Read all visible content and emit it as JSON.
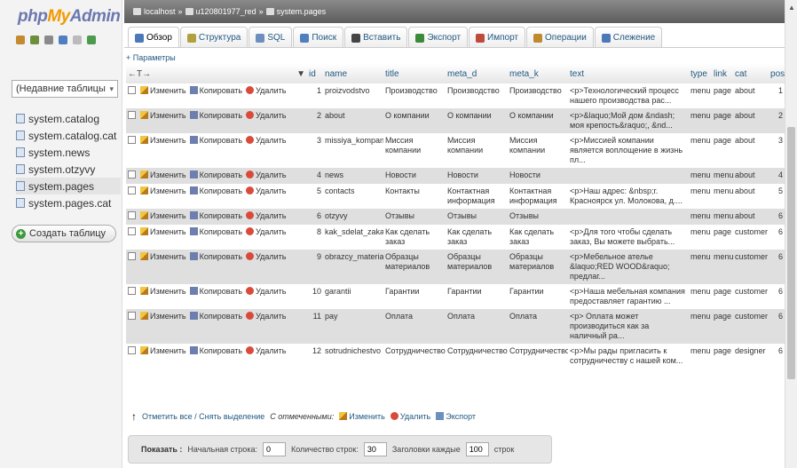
{
  "logo": {
    "php": "php",
    "my": "My",
    "admin": "Admin"
  },
  "left": {
    "recent_tables": "(Недавние таблицы",
    "tables": [
      "system.catalog",
      "system.catalog.cat",
      "system.news",
      "system.otzyvy",
      "system.pages",
      "system.pages.cat"
    ],
    "selected": "system.pages",
    "create_table": "Создать таблицу"
  },
  "breadcrumb": {
    "server": "localhost",
    "db": "u120801977_red",
    "table": "system.pages"
  },
  "tabs": [
    "Обзор",
    "Структура",
    "SQL",
    "Поиск",
    "Вставить",
    "Экспорт",
    "Импорт",
    "Операции",
    "Слежение"
  ],
  "params_label": "+ Параметры",
  "columns": [
    "id",
    "name",
    "title",
    "meta_d",
    "meta_k",
    "text",
    "type",
    "link",
    "cat",
    "pos"
  ],
  "actions": {
    "edit": "Изменить",
    "copy": "Копировать",
    "delete": "Удалить"
  },
  "rows": [
    {
      "id": "1",
      "name": "proizvodstvo",
      "title": "Производство",
      "meta_d": "Производство",
      "meta_k": "Производство",
      "text": "<p>Технологический процесс нашего производства рас...",
      "type": "menu",
      "link": "page",
      "cat": "about",
      "pos": "1"
    },
    {
      "id": "2",
      "name": "about",
      "title": "О компании",
      "meta_d": "О компании",
      "meta_k": "О компании",
      "text": "<p>&laquo;Мой дом &ndash; моя крепость&raquo;, &nd...",
      "type": "menu",
      "link": "page",
      "cat": "about",
      "pos": "2"
    },
    {
      "id": "3",
      "name": "missiya_kompanii",
      "title": "Миссия компании",
      "meta_d": "Миссия компании",
      "meta_k": "Миссия компании",
      "text": "<p>Миссией компании является воплощение в жизнь пл...",
      "type": "menu",
      "link": "page",
      "cat": "about",
      "pos": "3"
    },
    {
      "id": "4",
      "name": "news",
      "title": "Новости",
      "meta_d": "Новости",
      "meta_k": "Новости",
      "text": "",
      "type": "menu",
      "link": "menu",
      "cat": "about",
      "pos": "4"
    },
    {
      "id": "5",
      "name": "contacts",
      "title": "Контакты",
      "meta_d": "Контактная информация",
      "meta_k": "Контактная информация",
      "text": "<p>Наш адрес: &nbsp;г. Красноярск ул. Молокова, д....",
      "type": "menu",
      "link": "menu",
      "cat": "about",
      "pos": "5"
    },
    {
      "id": "6",
      "name": "otzyvy",
      "title": "Отзывы",
      "meta_d": "Отзывы",
      "meta_k": "Отзывы",
      "text": "",
      "type": "menu",
      "link": "menu",
      "cat": "about",
      "pos": "6"
    },
    {
      "id": "8",
      "name": "kak_sdelat_zakaz",
      "title": "Как сделать заказ",
      "meta_d": "Как сделать заказ",
      "meta_k": "Как сделать заказ",
      "text": "<p>Для того чтобы сделать заказ, Вы можете выбрать...",
      "type": "menu",
      "link": "page",
      "cat": "customer",
      "pos": "6"
    },
    {
      "id": "9",
      "name": "obrazcy_materialov",
      "title": "Образцы материалов",
      "meta_d": "Образцы материалов",
      "meta_k": "Образцы материалов",
      "text": "<p>Мебельное ателье &laquo;RED WOOD&raquo; предлаг...",
      "type": "menu",
      "link": "menu",
      "cat": "customer",
      "pos": "6"
    },
    {
      "id": "10",
      "name": "garantii",
      "title": "Гарантии",
      "meta_d": "Гарантии",
      "meta_k": "Гарантии",
      "text": "<p>Наша мебельная компания предоставляет гарантию ...",
      "type": "menu",
      "link": "page",
      "cat": "customer",
      "pos": "6"
    },
    {
      "id": "11",
      "name": "pay",
      "title": "Оплата",
      "meta_d": "Оплата",
      "meta_k": "Оплата",
      "text": "<p> Оплата может производиться как за наличный ра...",
      "type": "menu",
      "link": "page",
      "cat": "customer",
      "pos": "6"
    },
    {
      "id": "12",
      "name": "sotrudnichestvo",
      "title": "Сотрудничество",
      "meta_d": "Сотрудничество",
      "meta_k": "Сотрудничество",
      "text": "<p>Мы рады пригласить к сотрудничеству с нашей ком...",
      "type": "menu",
      "link": "page",
      "cat": "designer",
      "pos": "6"
    }
  ],
  "bottom": {
    "check_all": "Отметить все / Снять выделение",
    "with_selected": "С отмеченными:",
    "edit": "Изменить",
    "delete": "Удалить",
    "export": "Экспорт"
  },
  "pager": {
    "show": "Показать :",
    "start_label": "Начальная строка:",
    "start": "0",
    "count_label": "Количество строк:",
    "count": "30",
    "headers_label": "Заголовки каждые",
    "headers_every": "100",
    "rows_suffix": "строк"
  }
}
